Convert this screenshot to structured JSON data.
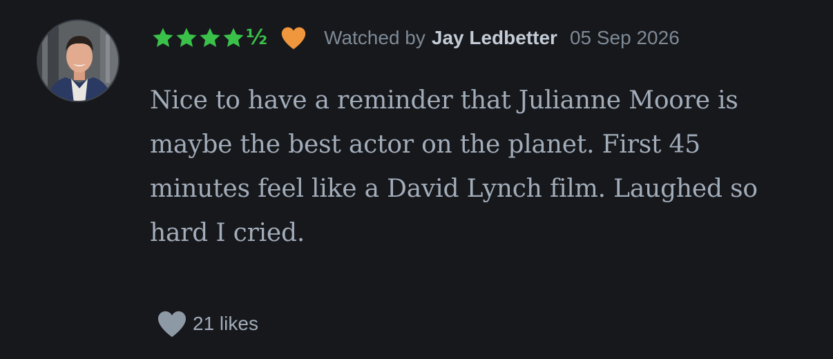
{
  "review": {
    "rating_half_glyph": "½",
    "rating_stars": 4.5,
    "liked": true,
    "watched_prefix": "Watched by",
    "username": "Jay Ledbetter",
    "date": "05 Sep 2026",
    "text": "Nice to have a reminder that Julianne Moore is maybe the best actor on the planet. First 45 minutes feel like a David Lynch film. Laughed so hard I cried.",
    "likes_label": "21 likes"
  },
  "icons": {
    "star": "star-icon",
    "liked": "heart-icon",
    "like_button": "heart-icon"
  },
  "colors": {
    "background": "#17181c",
    "star_green": "#3ac14a",
    "liked_orange": "#f0963c",
    "muted_text": "#7e8a96",
    "body_text": "#a2adba",
    "username_text": "#c3ccd6",
    "like_heart": "#8e99a6"
  }
}
